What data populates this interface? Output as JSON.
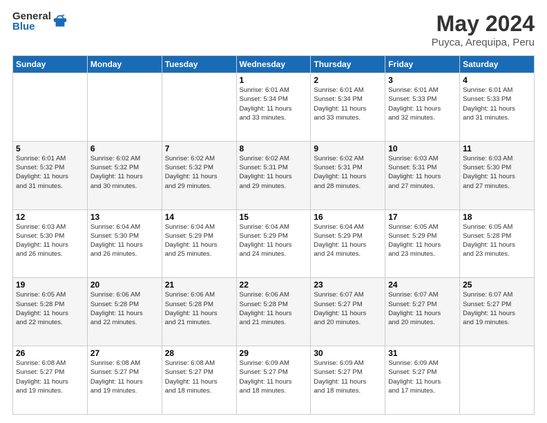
{
  "logo": {
    "general": "General",
    "blue": "Blue"
  },
  "header": {
    "title": "May 2024",
    "subtitle": "Puyca, Arequipa, Peru"
  },
  "days_of_week": [
    "Sunday",
    "Monday",
    "Tuesday",
    "Wednesday",
    "Thursday",
    "Friday",
    "Saturday"
  ],
  "weeks": [
    [
      {
        "day": "",
        "info": ""
      },
      {
        "day": "",
        "info": ""
      },
      {
        "day": "",
        "info": ""
      },
      {
        "day": "1",
        "info": "Sunrise: 6:01 AM\nSunset: 5:34 PM\nDaylight: 11 hours\nand 33 minutes."
      },
      {
        "day": "2",
        "info": "Sunrise: 6:01 AM\nSunset: 5:34 PM\nDaylight: 11 hours\nand 33 minutes."
      },
      {
        "day": "3",
        "info": "Sunrise: 6:01 AM\nSunset: 5:33 PM\nDaylight: 11 hours\nand 32 minutes."
      },
      {
        "day": "4",
        "info": "Sunrise: 6:01 AM\nSunset: 5:33 PM\nDaylight: 11 hours\nand 31 minutes."
      }
    ],
    [
      {
        "day": "5",
        "info": "Sunrise: 6:01 AM\nSunset: 5:32 PM\nDaylight: 11 hours\nand 31 minutes."
      },
      {
        "day": "6",
        "info": "Sunrise: 6:02 AM\nSunset: 5:32 PM\nDaylight: 11 hours\nand 30 minutes."
      },
      {
        "day": "7",
        "info": "Sunrise: 6:02 AM\nSunset: 5:32 PM\nDaylight: 11 hours\nand 29 minutes."
      },
      {
        "day": "8",
        "info": "Sunrise: 6:02 AM\nSunset: 5:31 PM\nDaylight: 11 hours\nand 29 minutes."
      },
      {
        "day": "9",
        "info": "Sunrise: 6:02 AM\nSunset: 5:31 PM\nDaylight: 11 hours\nand 28 minutes."
      },
      {
        "day": "10",
        "info": "Sunrise: 6:03 AM\nSunset: 5:31 PM\nDaylight: 11 hours\nand 27 minutes."
      },
      {
        "day": "11",
        "info": "Sunrise: 6:03 AM\nSunset: 5:30 PM\nDaylight: 11 hours\nand 27 minutes."
      }
    ],
    [
      {
        "day": "12",
        "info": "Sunrise: 6:03 AM\nSunset: 5:30 PM\nDaylight: 11 hours\nand 26 minutes."
      },
      {
        "day": "13",
        "info": "Sunrise: 6:04 AM\nSunset: 5:30 PM\nDaylight: 11 hours\nand 26 minutes."
      },
      {
        "day": "14",
        "info": "Sunrise: 6:04 AM\nSunset: 5:29 PM\nDaylight: 11 hours\nand 25 minutes."
      },
      {
        "day": "15",
        "info": "Sunrise: 6:04 AM\nSunset: 5:29 PM\nDaylight: 11 hours\nand 24 minutes."
      },
      {
        "day": "16",
        "info": "Sunrise: 6:04 AM\nSunset: 5:29 PM\nDaylight: 11 hours\nand 24 minutes."
      },
      {
        "day": "17",
        "info": "Sunrise: 6:05 AM\nSunset: 5:29 PM\nDaylight: 11 hours\nand 23 minutes."
      },
      {
        "day": "18",
        "info": "Sunrise: 6:05 AM\nSunset: 5:28 PM\nDaylight: 11 hours\nand 23 minutes."
      }
    ],
    [
      {
        "day": "19",
        "info": "Sunrise: 6:05 AM\nSunset: 5:28 PM\nDaylight: 11 hours\nand 22 minutes."
      },
      {
        "day": "20",
        "info": "Sunrise: 6:06 AM\nSunset: 5:28 PM\nDaylight: 11 hours\nand 22 minutes."
      },
      {
        "day": "21",
        "info": "Sunrise: 6:06 AM\nSunset: 5:28 PM\nDaylight: 11 hours\nand 21 minutes."
      },
      {
        "day": "22",
        "info": "Sunrise: 6:06 AM\nSunset: 5:28 PM\nDaylight: 11 hours\nand 21 minutes."
      },
      {
        "day": "23",
        "info": "Sunrise: 6:07 AM\nSunset: 5:27 PM\nDaylight: 11 hours\nand 20 minutes."
      },
      {
        "day": "24",
        "info": "Sunrise: 6:07 AM\nSunset: 5:27 PM\nDaylight: 11 hours\nand 20 minutes."
      },
      {
        "day": "25",
        "info": "Sunrise: 6:07 AM\nSunset: 5:27 PM\nDaylight: 11 hours\nand 19 minutes."
      }
    ],
    [
      {
        "day": "26",
        "info": "Sunrise: 6:08 AM\nSunset: 5:27 PM\nDaylight: 11 hours\nand 19 minutes."
      },
      {
        "day": "27",
        "info": "Sunrise: 6:08 AM\nSunset: 5:27 PM\nDaylight: 11 hours\nand 19 minutes."
      },
      {
        "day": "28",
        "info": "Sunrise: 6:08 AM\nSunset: 5:27 PM\nDaylight: 11 hours\nand 18 minutes."
      },
      {
        "day": "29",
        "info": "Sunrise: 6:09 AM\nSunset: 5:27 PM\nDaylight: 11 hours\nand 18 minutes."
      },
      {
        "day": "30",
        "info": "Sunrise: 6:09 AM\nSunset: 5:27 PM\nDaylight: 11 hours\nand 18 minutes."
      },
      {
        "day": "31",
        "info": "Sunrise: 6:09 AM\nSunset: 5:27 PM\nDaylight: 11 hours\nand 17 minutes."
      },
      {
        "day": "",
        "info": ""
      }
    ]
  ]
}
